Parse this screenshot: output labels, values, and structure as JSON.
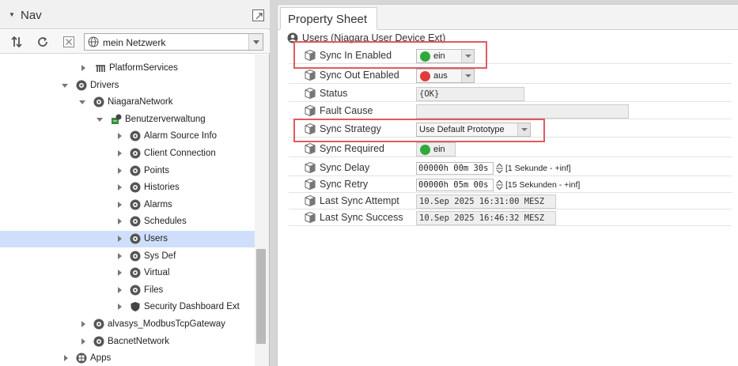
{
  "nav": {
    "title": "Nav",
    "station_combo": "mein Netzwerk",
    "tree": [
      {
        "label": "PlatformServices",
        "level": 0,
        "toggle": "right",
        "icon": "platform-services-icon"
      },
      {
        "label": "Drivers",
        "level": 1,
        "toggle": "down",
        "icon": "drivers-icon"
      },
      {
        "label": "NiagaraNetwork",
        "level": 2,
        "toggle": "down",
        "icon": "niagara-network-icon"
      },
      {
        "label": "Benutzerverwaltung",
        "level": 3,
        "toggle": "down",
        "icon": "niagara-station-icon"
      },
      {
        "label": "Alarm Source Info",
        "level": 4,
        "toggle": "right",
        "icon": "alarm-source-icon"
      },
      {
        "label": "Client Connection",
        "level": 4,
        "toggle": "right",
        "icon": "client-connection-icon"
      },
      {
        "label": "Points",
        "level": 4,
        "toggle": "right",
        "icon": "points-icon"
      },
      {
        "label": "Histories",
        "level": 4,
        "toggle": "right",
        "icon": "histories-icon"
      },
      {
        "label": "Alarms",
        "level": 4,
        "toggle": "right",
        "icon": "alarms-icon"
      },
      {
        "label": "Schedules",
        "level": 4,
        "toggle": "right",
        "icon": "schedules-icon"
      },
      {
        "label": "Users",
        "level": 4,
        "toggle": "right",
        "icon": "users-icon",
        "selected": true
      },
      {
        "label": "Sys Def",
        "level": 4,
        "toggle": "right",
        "icon": "sysdef-icon"
      },
      {
        "label": "Virtual",
        "level": 4,
        "toggle": "right",
        "icon": "virtual-icon"
      },
      {
        "label": "Files",
        "level": 4,
        "toggle": "right",
        "icon": "files-icon"
      },
      {
        "label": "Security Dashboard Ext",
        "level": 4,
        "toggle": "right",
        "icon": "security-shield-icon"
      },
      {
        "label": "alvasys_ModbusTcpGateway",
        "level": 2,
        "toggle": "right",
        "icon": "network-icon"
      },
      {
        "label": "BacnetNetwork",
        "level": 2,
        "toggle": "right",
        "icon": "network-icon"
      },
      {
        "label": "Apps",
        "level": 1,
        "toggle": "right",
        "icon": "apps-icon"
      }
    ]
  },
  "property_sheet": {
    "tab": "Property Sheet",
    "root_label": "Users  (Niagara User Device Ext)",
    "rows": {
      "sync_in_enabled": {
        "name": "Sync In Enabled",
        "value": "ein",
        "status_color": "#2eaa3c"
      },
      "sync_out_enabled": {
        "name": "Sync Out Enabled",
        "value": "aus",
        "status_color": "#e23b3b"
      },
      "status": {
        "name": "Status",
        "value": "{OK}"
      },
      "fault_cause": {
        "name": "Fault Cause",
        "value": ""
      },
      "sync_strategy": {
        "name": "Sync Strategy",
        "value": "Use Default Prototype"
      },
      "sync_required": {
        "name": "Sync Required",
        "value": "ein",
        "status_color": "#2eaa3c"
      },
      "sync_delay": {
        "name": "Sync Delay",
        "value": "00000h 00m 30s",
        "range": "[1 Sekunde - +inf]"
      },
      "sync_retry": {
        "name": "Sync Retry",
        "value": "00000h 05m 00s",
        "range": "[15 Sekunden - +inf]"
      },
      "last_sync_attempt": {
        "name": "Last Sync Attempt",
        "value": "10.Sep 2025 16:31:00 MESZ"
      },
      "last_sync_success": {
        "name": "Last Sync Success",
        "value": "10.Sep 2025 16:46:32 MESZ"
      }
    }
  },
  "colors": {
    "highlight": "#e05a5f",
    "selection": "#cfdffb"
  }
}
